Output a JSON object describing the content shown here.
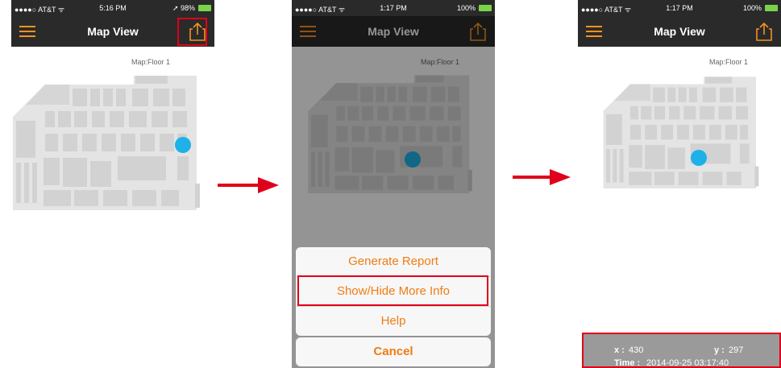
{
  "colors": {
    "accent": "#f39222",
    "navbar": "#2a2a2a",
    "highlight": "#e0001a",
    "location": "#1fb1e8",
    "battery": "#7bd34a",
    "info_panel": "#9a9a9a"
  },
  "icons": {
    "menu": "hamburger-menu-icon",
    "share": "share-icon",
    "location": "location-dot-icon",
    "flow_arrow": "right-arrow-icon"
  },
  "screens": [
    {
      "status": {
        "carrier": "●●●●○ AT&T ᯤ",
        "time": "5:16 PM",
        "battery": "➚ 98%"
      },
      "nav_title": "Map View",
      "floor_label": "Map:Floor 1"
    },
    {
      "status": {
        "carrier": "●●●●○ AT&T ᯤ",
        "time": "1:17 PM",
        "battery": "100%"
      },
      "nav_title": "Map View",
      "floor_label": "Map:Floor 1",
      "action_sheet": {
        "items": [
          "Generate Report",
          "Show/Hide More Info",
          "Help"
        ],
        "cancel": "Cancel"
      }
    },
    {
      "status": {
        "carrier": "●●●●○ AT&T ᯤ",
        "time": "1:17 PM",
        "battery": "100%"
      },
      "nav_title": "Map View",
      "floor_label": "Map:Floor 1",
      "info": {
        "x_label": "x :",
        "x_value": "430",
        "y_label": "y :",
        "y_value": "297",
        "time_label": "Time :",
        "time_value": "2014-09-25 03:17:40"
      }
    }
  ]
}
